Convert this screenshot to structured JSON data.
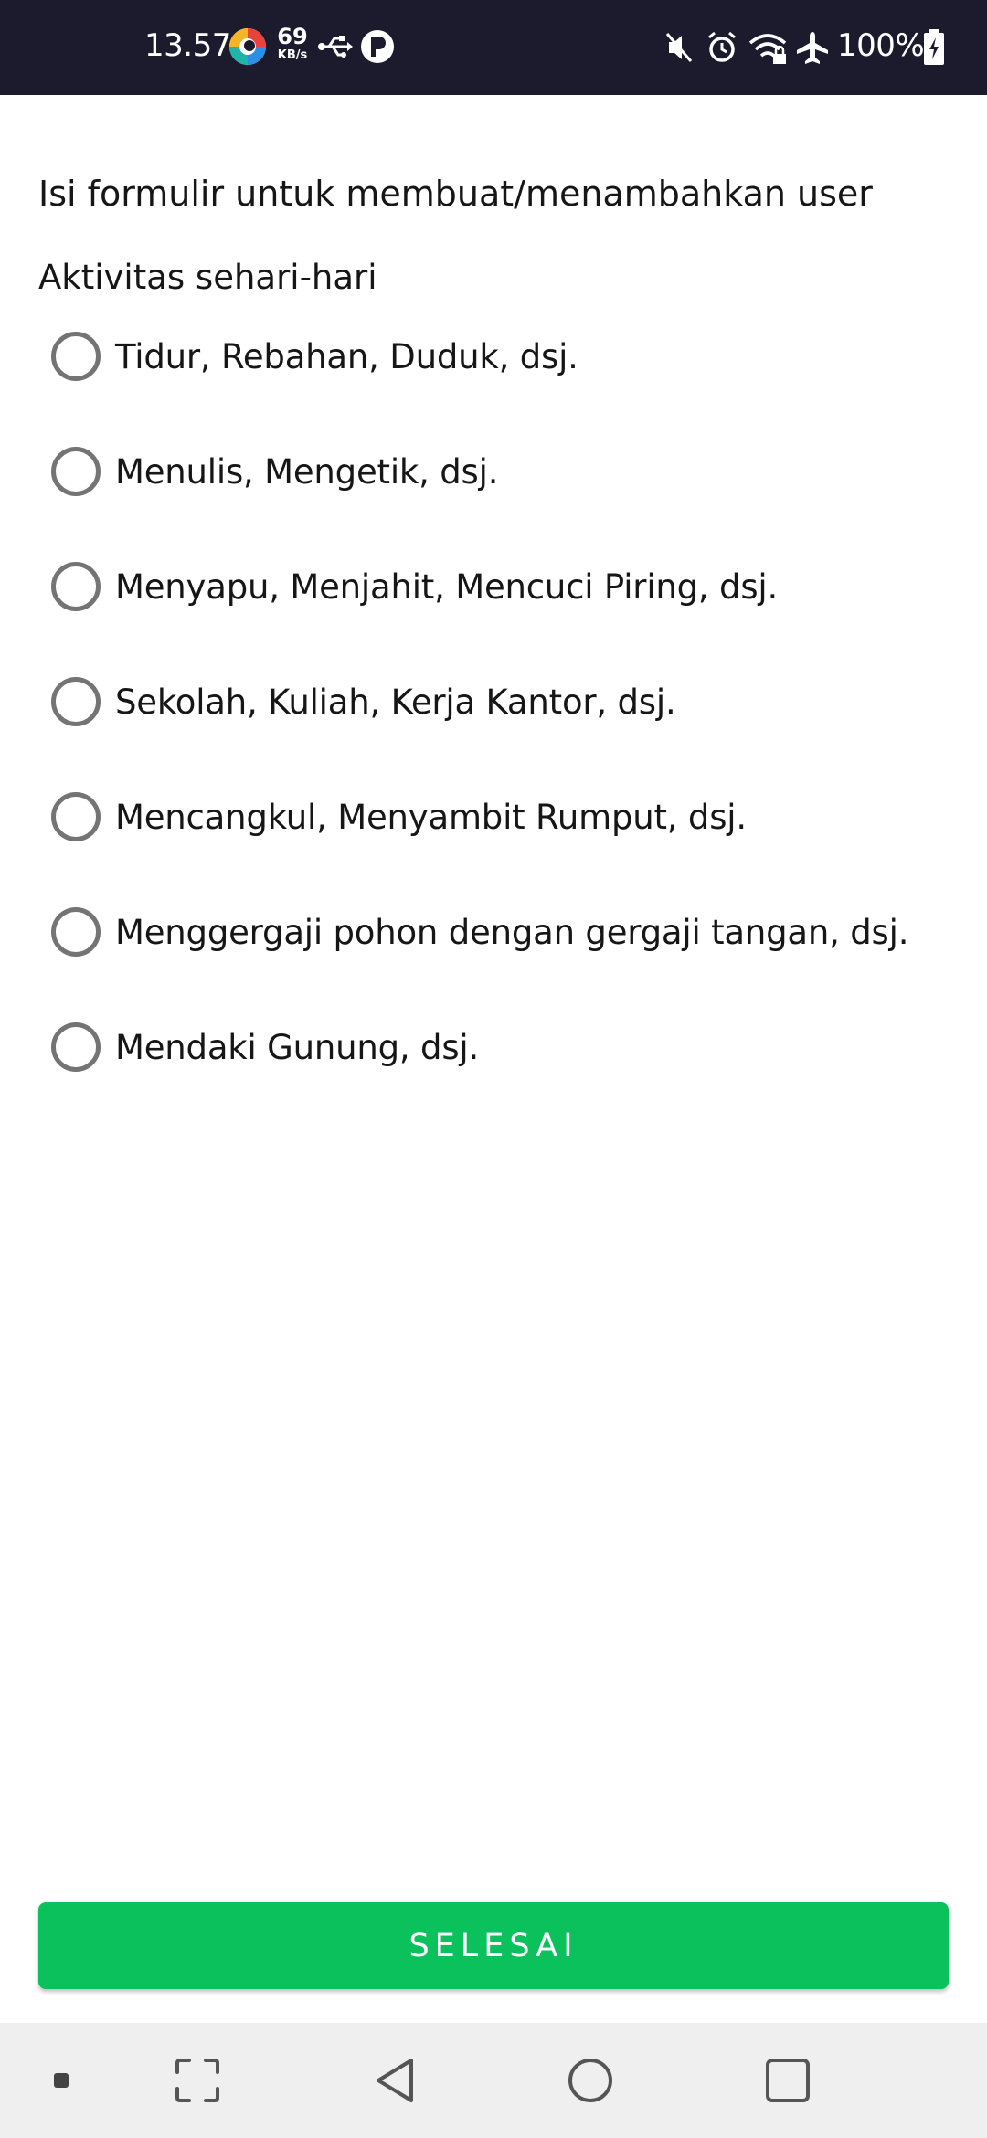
{
  "status_bar": {
    "time": "13.57",
    "network_speed_value": "69",
    "network_speed_unit": "KB/s",
    "battery_percent": "100%",
    "icons": [
      "browser-app-icon",
      "usb-icon",
      "p-app-icon",
      "mute-icon",
      "alarm-icon",
      "wifi-icon",
      "airplane-icon",
      "battery-icon"
    ]
  },
  "form": {
    "title": "Isi formulir untuk membuat/menambahkan user",
    "section_label": "Aktivitas sehari-hari",
    "options": [
      {
        "label": "Tidur, Rebahan, Duduk, dsj.",
        "selected": false
      },
      {
        "label": "Menulis, Mengetik, dsj.",
        "selected": false
      },
      {
        "label": "Menyapu, Menjahit, Mencuci Piring, dsj.",
        "selected": false
      },
      {
        "label": "Sekolah, Kuliah, Kerja Kantor, dsj.",
        "selected": false
      },
      {
        "label": "Mencangkul, Menyambit Rumput, dsj.",
        "selected": false
      },
      {
        "label": "Menggergaji pohon dengan gergaji tangan, dsj.",
        "selected": false
      },
      {
        "label": "Mendaki Gunung, dsj.",
        "selected": false
      }
    ],
    "submit_label": "SELESAI"
  },
  "nav_bar": {
    "items": [
      "dot-icon",
      "screenshot-frame-icon",
      "back-icon",
      "home-icon",
      "recents-icon"
    ]
  },
  "colors": {
    "status_bar_bg": "#1c1b2d",
    "accent_green": "#0bc15c",
    "radio_border": "#747474",
    "nav_bar_bg": "#efefef"
  }
}
